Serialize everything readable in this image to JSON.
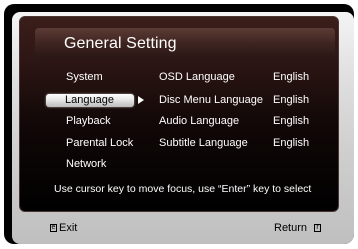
{
  "header": {
    "title": "General Setting"
  },
  "sidebar": {
    "items": [
      {
        "label": "System"
      },
      {
        "label": "Language",
        "selected": true
      },
      {
        "label": "Playback"
      },
      {
        "label": "Parental Lock"
      },
      {
        "label": "Network"
      }
    ]
  },
  "settings": [
    {
      "label": "OSD Language",
      "value": "English"
    },
    {
      "label": "Disc Menu Language",
      "value": "English"
    },
    {
      "label": "Audio Language",
      "value": "English"
    },
    {
      "label": "Subtitle Language",
      "value": "English"
    }
  ],
  "hint": {
    "text": "Use cursor key to move focus, use “Enter” key to select"
  },
  "footer": {
    "exit_label": "Exit",
    "return_label": "Return"
  }
}
